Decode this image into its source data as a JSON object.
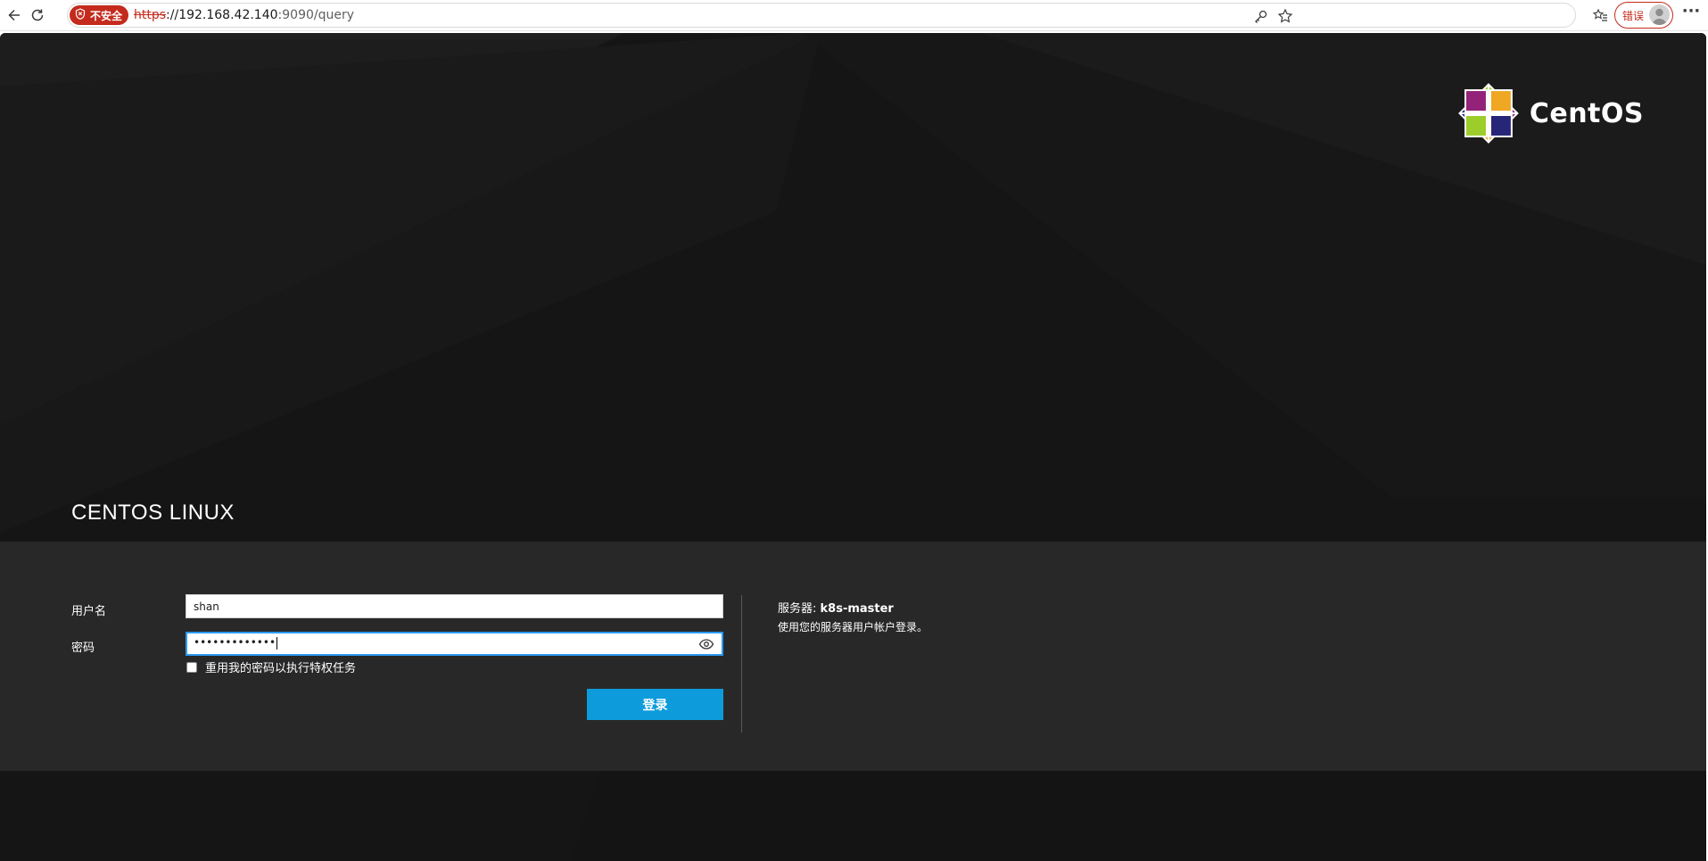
{
  "browser": {
    "insecure_label": "不安全",
    "url_scheme": "https",
    "url_rest_host": "://192.168.42.140",
    "url_rest_path": ":9090/query",
    "error_label": "错误",
    "more_label": "···"
  },
  "brand": {
    "name": "CentOS"
  },
  "page": {
    "os_title": "CENTOS LINUX"
  },
  "login": {
    "username_label": "用户名",
    "username_value": "shan",
    "password_label": "密码",
    "password_masked": "•••••••••••••",
    "reuse_password_label": "重用我的密码以执行特权任务",
    "reuse_password_checked": false,
    "submit_label": "登录"
  },
  "server_info": {
    "server_prefix": "服务器: ",
    "server_name": "k8s-master",
    "hint": "使用您的服务器用户帐户登录。"
  },
  "colors": {
    "page_bg": "#151515",
    "accent_button": "#0d9bdb",
    "focus_border": "#2b9af3",
    "insecure_red": "#c42b1c"
  }
}
